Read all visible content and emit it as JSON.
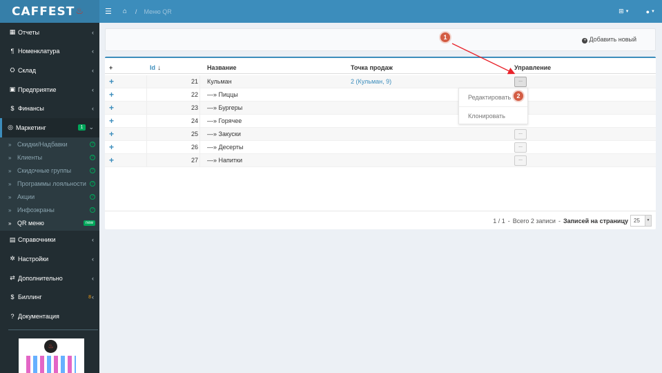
{
  "logo": {
    "text": "CAFFEST",
    "flame": "♨"
  },
  "sidebar": {
    "items": [
      {
        "icon": "chart-icon",
        "glyph": "▦",
        "label": "Отчеты"
      },
      {
        "icon": "cutlery-icon",
        "glyph": "¶",
        "label": "Номенклатура"
      },
      {
        "icon": "warehouse-icon",
        "glyph": "⛭",
        "label": "Склад"
      },
      {
        "icon": "building-icon",
        "glyph": "▣",
        "label": "Предприятие"
      },
      {
        "icon": "dollar-icon",
        "glyph": "$",
        "label": "Финансы"
      },
      {
        "icon": "marketing-icon",
        "glyph": "◎",
        "label": "Маркетинг",
        "badge": "1"
      }
    ],
    "submenu": [
      {
        "label": "Скидки/Надбавки"
      },
      {
        "label": "Клиенты"
      },
      {
        "label": "Скидочные группы"
      },
      {
        "label": "Программы лояльности"
      },
      {
        "label": "Акции"
      },
      {
        "label": "Инфоэкраны"
      },
      {
        "label": "QR меню",
        "badge": "new"
      }
    ],
    "items_after": [
      {
        "icon": "book-icon",
        "glyph": "▤",
        "label": "Справочники"
      },
      {
        "icon": "cog-icon",
        "glyph": "✲",
        "label": "Настройки"
      },
      {
        "icon": "exchange-icon",
        "glyph": "⇄",
        "label": "Дополнительно"
      },
      {
        "icon": "dollar-icon",
        "glyph": "$",
        "label": "Биллинг",
        "badge": "8"
      },
      {
        "icon": "question-icon",
        "glyph": "?",
        "label": "Документация"
      }
    ]
  },
  "topbar": {
    "breadcrumb_sep": "/",
    "breadcrumb_current": "Меню QR"
  },
  "toolbar": {
    "add_new_label": "Добавить новый"
  },
  "table": {
    "headers": {
      "plus": "+",
      "id": "Id",
      "sort": "↓",
      "name": "Название",
      "pos": "Точка продаж",
      "mgmt": "Управление"
    },
    "rows": [
      {
        "id": "21",
        "name": "Кульман",
        "pos": "2 (Кульман, 9)"
      },
      {
        "id": "22",
        "name": "—» Пиццы",
        "pos": ""
      },
      {
        "id": "23",
        "name": "—» Бургеры",
        "pos": ""
      },
      {
        "id": "24",
        "name": "—» Горячее",
        "pos": ""
      },
      {
        "id": "25",
        "name": "—» Закуски",
        "pos": ""
      },
      {
        "id": "26",
        "name": "—» Десерты",
        "pos": ""
      },
      {
        "id": "27",
        "name": "—» Напитки",
        "pos": ""
      }
    ],
    "row_button": "...",
    "dropdown": {
      "edit": "Редактировать",
      "clone": "Клонировать"
    }
  },
  "footer": {
    "pages": "1 / 1",
    "sep": "-",
    "total": "Всего 2 записи",
    "per_page_label": "Записей на страницу",
    "per_page_value": "25"
  },
  "markers": {
    "m1": "1",
    "m2": "2"
  },
  "colors": {
    "topbar": "#3c8dbc",
    "sidebar": "#222d32",
    "marker": "#d35c43",
    "arrow": "#e8232b"
  }
}
